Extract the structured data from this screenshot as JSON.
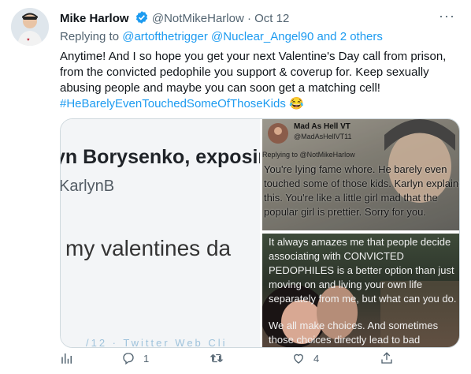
{
  "tweet": {
    "author_name": "Mike Harlow",
    "author_handle": "@NotMikeHarlow",
    "separator": "·",
    "date": "Oct 12",
    "more_label": "···",
    "reply_prefix": "Replying to",
    "reply_to_1": "@artofthetrigger",
    "reply_to_2": "@Nuclear_Angel90",
    "reply_suffix": "and 2 others",
    "body_text": "Anytime! And I so hope you get your next Valentine's Day call from prison, from the convicted pedophile you support & coverup for. Keep sexually abusing people and maybe you can soon get a matching cell!",
    "hashtag": "#HeBarelyEvenTouchedSomeOfThoseKids",
    "emoji": "😂",
    "accent_color": "#1d9bf0"
  },
  "media": {
    "left": {
      "line1": "yn Borysenko, exposin",
      "line2": "KarlynB",
      "line3": "my valentines da",
      "line4": "/12 · Twitter Web Cli"
    },
    "right_top": {
      "name": "Mad As Hell VT",
      "handle": "@MadAsHellVT11",
      "reply": "Replying to @NotMikeHarlow",
      "text": "You're lying fame whore. He barely even touched some of those kids. Karlyn explained this. You're like a little girl mad that the popular girl is prettier. Sorry for you."
    },
    "right_bottom": {
      "text": "It always amazes me that people decide associating with CONVICTED PEDOPHILES is a better option than just moving on and living your own life separately from me, but what can you do.",
      "text2": "We all make choices. And sometimes those choices directly lead to bad"
    }
  },
  "actions": {
    "analytics_icon": "analytics-icon",
    "reply_count": "1",
    "retweet_count": "",
    "like_count": "4",
    "share_icon": "share-icon"
  }
}
